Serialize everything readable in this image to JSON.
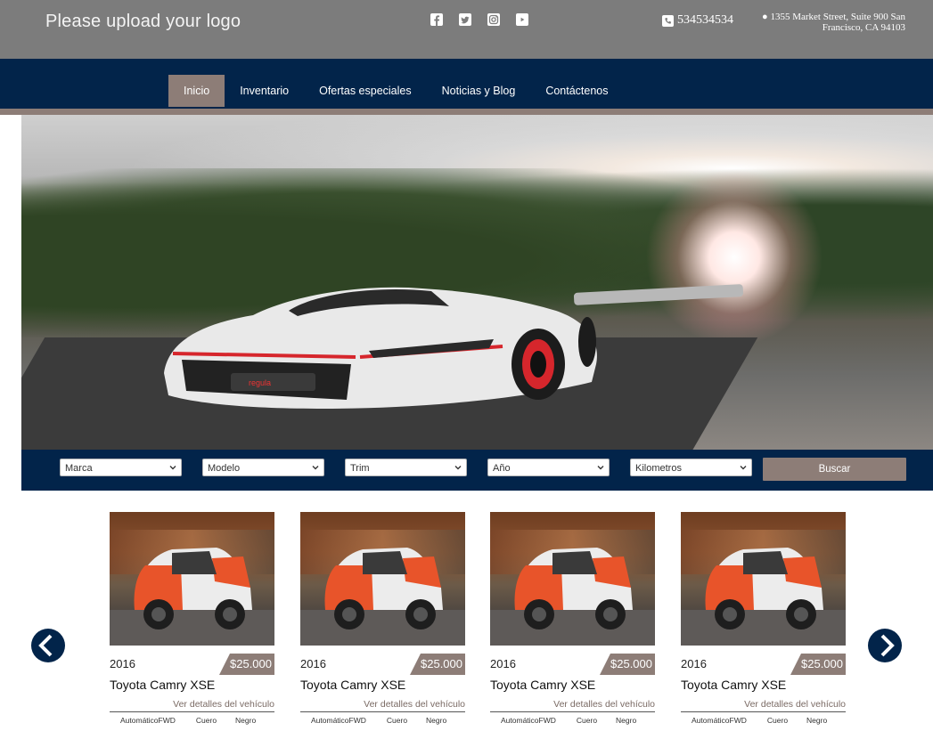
{
  "header": {
    "logo_text": "Please upload your logo",
    "social_icons": [
      "facebook-icon",
      "twitter-icon",
      "instagram-icon",
      "youtube-icon"
    ],
    "phone": "534534534",
    "address_line1": "1355 Market Street, Suite 900 San",
    "address_line2": "Francisco, CA 94103"
  },
  "nav": {
    "items": [
      {
        "label": "Inicio",
        "active": true
      },
      {
        "label": "Inventario",
        "active": false
      },
      {
        "label": "Ofertas especiales",
        "active": false
      },
      {
        "label": "Noticias y Blog",
        "active": false
      },
      {
        "label": "Contáctenos",
        "active": false
      }
    ]
  },
  "search": {
    "filters": [
      "Marca",
      "Modelo",
      "Trim",
      "Año",
      "Kilometros"
    ],
    "button_label": "Buscar"
  },
  "listings": [
    {
      "year": "2016",
      "price": "$25.000",
      "model": "Toyota Camry XSE",
      "details_link": "Ver detalles del vehículo",
      "transmission": "Automático",
      "drive": "FWD",
      "interior": "Cuero",
      "color": "Negro"
    },
    {
      "year": "2016",
      "price": "$25.000",
      "model": "Toyota Camry XSE",
      "details_link": "Ver detalles del vehículo",
      "transmission": "Automático",
      "drive": "FWD",
      "interior": "Cuero",
      "color": "Negro"
    },
    {
      "year": "2016",
      "price": "$25.000",
      "model": "Toyota Camry XSE",
      "details_link": "Ver detalles del vehículo",
      "transmission": "Automático",
      "drive": "FWD",
      "interior": "Cuero",
      "color": "Negro"
    },
    {
      "year": "2016",
      "price": "$25.000",
      "model": "Toyota Camry XSE",
      "details_link": "Ver detalles del vehículo",
      "transmission": "Automático",
      "drive": "FWD",
      "interior": "Cuero",
      "color": "Negro"
    }
  ],
  "colors": {
    "navy": "#02244a",
    "accent": "#8d7d77",
    "topbar": "#7c7c7c"
  }
}
